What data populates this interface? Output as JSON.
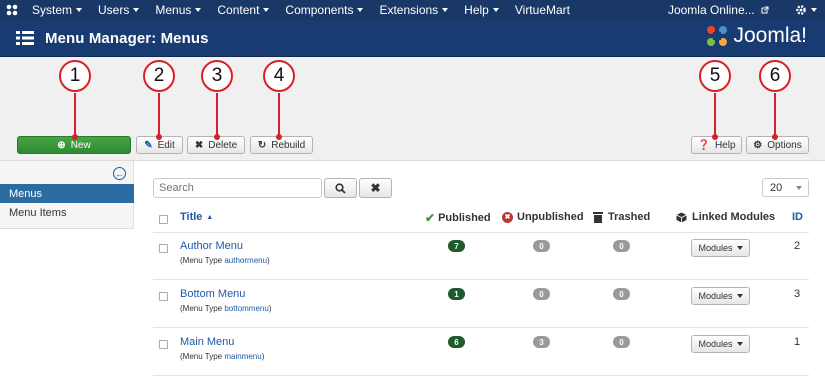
{
  "navbar": {
    "logo_icon": "joomla-icon",
    "menus": [
      "System",
      "Users",
      "Menus",
      "Content",
      "Components",
      "Extensions",
      "Help",
      "VirtueMart"
    ],
    "site_link": "Joomla Online...",
    "settings_icon": "gear-icon"
  },
  "header": {
    "title": "Menu Manager: Menus",
    "brand": "Joomla!",
    "accent": "#183c71"
  },
  "toolbar": {
    "new_label": "New",
    "edit_label": "Edit",
    "delete_label": "Delete",
    "rebuild_label": "Rebuild",
    "help_label": "Help",
    "options_label": "Options",
    "callouts": [
      "1",
      "2",
      "3",
      "4",
      "5",
      "6"
    ]
  },
  "sidebar": {
    "items": [
      {
        "label": "Menus",
        "active": true
      },
      {
        "label": "Menu Items",
        "active": false
      }
    ]
  },
  "filters": {
    "search_placeholder": "Search",
    "limit": "20"
  },
  "table": {
    "columns": {
      "title": "Title",
      "published": "Published",
      "unpublished": "Unpublished",
      "trashed": "Trashed",
      "modules": "Linked Modules",
      "id": "ID"
    },
    "type_prefix": "(Menu Type",
    "type_suffix": ")",
    "modules_button": "Modules",
    "rows": [
      {
        "title": "Author Menu",
        "type": "authormenu",
        "published": "7",
        "unpublished": "0",
        "trashed": "0",
        "id": "2"
      },
      {
        "title": "Bottom Menu",
        "type": "bottommenu",
        "published": "1",
        "unpublished": "0",
        "trashed": "0",
        "id": "3"
      },
      {
        "title": "Main Menu",
        "type": "mainmenu",
        "published": "6",
        "unpublished": "3",
        "trashed": "0",
        "id": "1"
      }
    ]
  },
  "colors": {
    "navbar": "#1a3867",
    "new_button": "#46a546",
    "link": "#1f5aa6",
    "callout": "#d9202a",
    "published_badge": "#1f5a2c"
  }
}
